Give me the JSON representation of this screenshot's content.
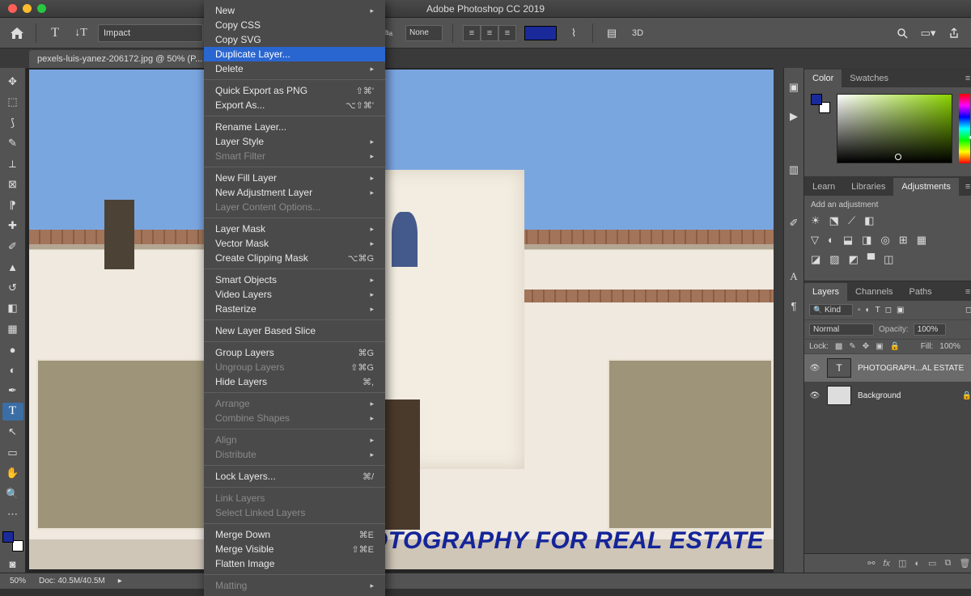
{
  "app_title": "Adobe Photoshop CC 2019",
  "doc_tab": "pexels-luis-yanez-206172.jpg @ 50% (P...",
  "optbar": {
    "font": "Impact",
    "aa": "None",
    "color": "#1a2a9a"
  },
  "canvas_text": "PHOTOGRAPHY FOR REAL ESTATE",
  "statusbar": {
    "zoom": "50%",
    "docinfo": "Doc: 40.5M/40.5M"
  },
  "panels": {
    "color_tab": "Color",
    "swatches_tab": "Swatches",
    "learn_tab": "Learn",
    "libraries_tab": "Libraries",
    "adjust_tab": "Adjustments",
    "adjust_label": "Add an adjustment",
    "layers_tab": "Layers",
    "channels_tab": "Channels",
    "paths_tab": "Paths",
    "kind": "Kind",
    "blend": "Normal",
    "opacity_lbl": "Opacity:",
    "opacity_val": "100%",
    "lock_lbl": "Lock:",
    "fill_lbl": "Fill:",
    "fill_val": "100%",
    "layer1": "PHOTOGRAPH...AL ESTATE",
    "layer2": "Background"
  },
  "menu": {
    "new": "New",
    "copycss": "Copy CSS",
    "copysvg": "Copy SVG",
    "dup": "Duplicate Layer...",
    "del": "Delete",
    "qexport": "Quick Export as PNG",
    "qexport_sc": "⇧⌘'",
    "exportas": "Export As...",
    "exportas_sc": "⌥⇧⌘'",
    "rename": "Rename Layer...",
    "lstyle": "Layer Style",
    "sfilter": "Smart Filter",
    "nfill": "New Fill Layer",
    "nadj": "New Adjustment Layer",
    "lcopts": "Layer Content Options...",
    "lmask": "Layer Mask",
    "vmask": "Vector Mask",
    "cclip": "Create Clipping Mask",
    "cclip_sc": "⌥⌘G",
    "sobj": "Smart Objects",
    "vlayers": "Video Layers",
    "raster": "Rasterize",
    "nlbslice": "New Layer Based Slice",
    "group": "Group Layers",
    "group_sc": "⌘G",
    "ungroup": "Ungroup Layers",
    "ungroup_sc": "⇧⌘G",
    "hide": "Hide Layers",
    "hide_sc": "⌘,",
    "arrange": "Arrange",
    "cshapes": "Combine Shapes",
    "align": "Align",
    "dist": "Distribute",
    "locklayers": "Lock Layers...",
    "locklayers_sc": "⌘/",
    "link": "Link Layers",
    "sellink": "Select Linked Layers",
    "mdown": "Merge Down",
    "mdown_sc": "⌘E",
    "mvis": "Merge Visible",
    "mvis_sc": "⇧⌘E",
    "flatten": "Flatten Image",
    "matting": "Matting"
  }
}
